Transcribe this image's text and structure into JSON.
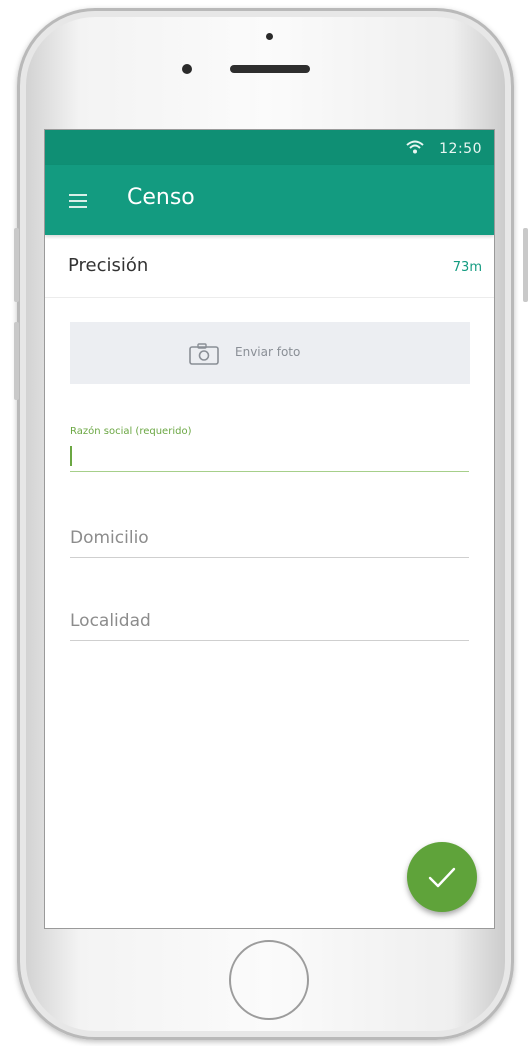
{
  "status_bar": {
    "time": "12:50",
    "wifi_icon": "wifi-icon"
  },
  "app_bar": {
    "title": "Censo",
    "menu_icon": "menu-icon"
  },
  "precision": {
    "label": "Precisión",
    "value": "73m"
  },
  "photo_button": {
    "label": "Enviar foto",
    "icon": "camera-icon"
  },
  "form": {
    "razon_social": {
      "label": "Razón social (requerido)",
      "value": ""
    },
    "domicilio": {
      "placeholder": "Domicilio",
      "value": ""
    },
    "localidad": {
      "placeholder": "Localidad",
      "value": ""
    }
  },
  "fab": {
    "icon": "check-icon"
  },
  "colors": {
    "primary": "#139b80",
    "status": "#0f8f74",
    "accent": "#5fa33a"
  }
}
